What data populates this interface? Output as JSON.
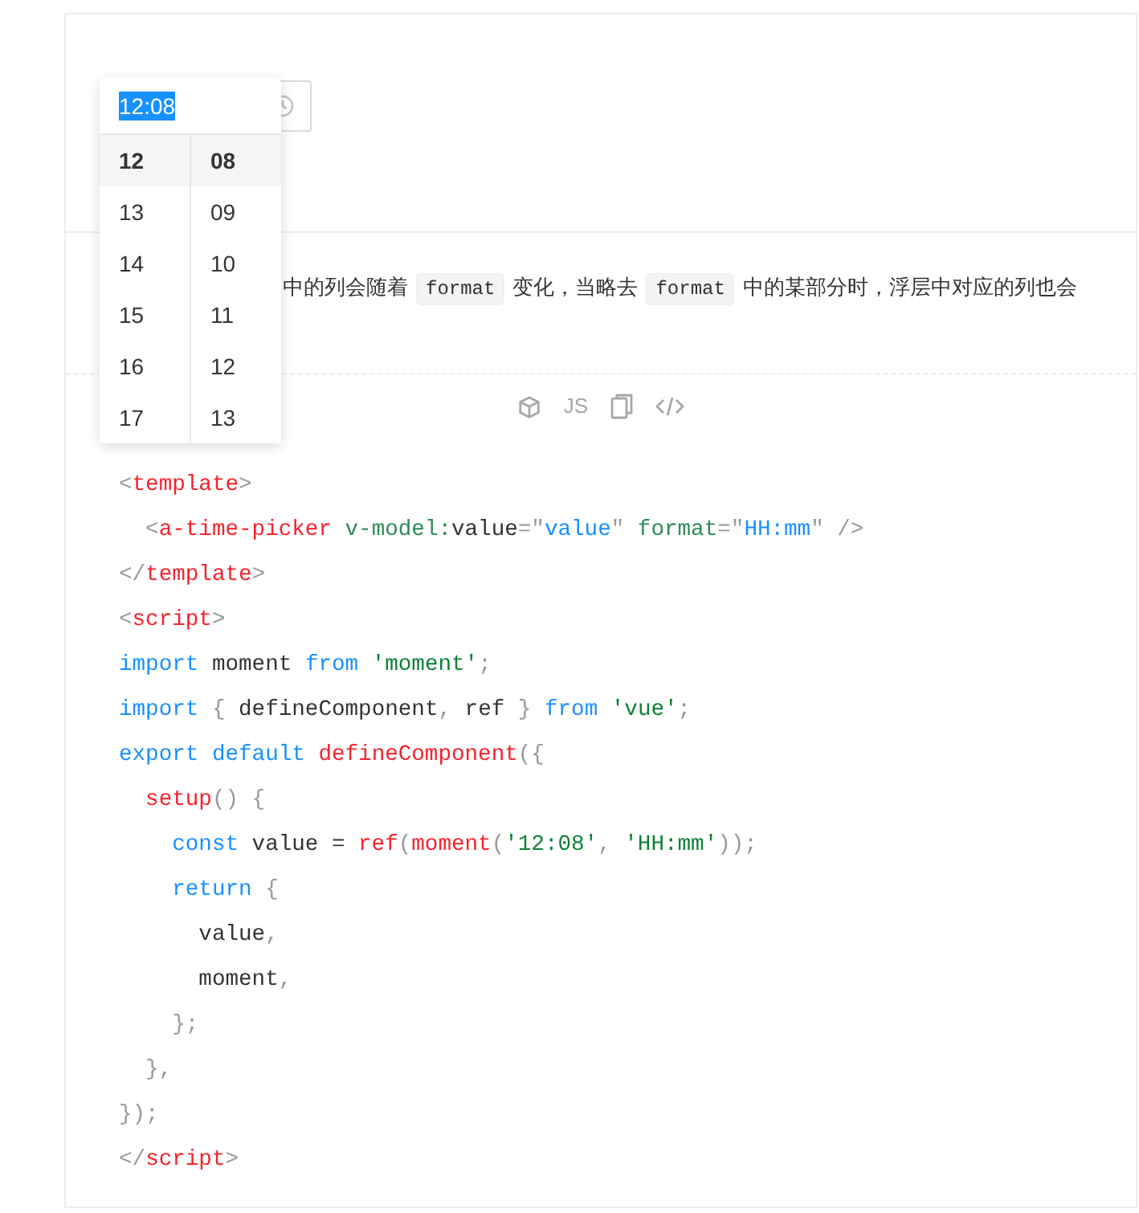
{
  "time_picker": {
    "value": "12:08",
    "columns": [
      {
        "items": [
          {
            "label": "12",
            "selected": true
          },
          {
            "label": "13",
            "selected": false
          },
          {
            "label": "14",
            "selected": false
          },
          {
            "label": "15",
            "selected": false
          },
          {
            "label": "16",
            "selected": false
          },
          {
            "label": "17",
            "selected": false
          }
        ]
      },
      {
        "items": [
          {
            "label": "08",
            "selected": true
          },
          {
            "label": "09",
            "selected": false
          },
          {
            "label": "10",
            "selected": false
          },
          {
            "label": "11",
            "selected": false
          },
          {
            "label": "12",
            "selected": false
          },
          {
            "label": "13",
            "selected": false
          }
        ]
      }
    ]
  },
  "description": [
    {
      "kind": "text",
      "text": "中的列会随着"
    },
    {
      "kind": "code",
      "text": "format"
    },
    {
      "kind": "text",
      "text": "变化，当略去"
    },
    {
      "kind": "code",
      "text": "format"
    },
    {
      "kind": "text",
      "text": "中的某部分时，浮层中对应的列也会"
    }
  ],
  "toolbar": {
    "buttons": [
      {
        "kind": "cube"
      },
      {
        "kind": "js",
        "label": "JS"
      },
      {
        "kind": "copy"
      },
      {
        "kind": "code"
      }
    ]
  },
  "code_lines": [
    {
      "tokens": [
        {
          "kind": "punct",
          "text": "<"
        },
        {
          "kind": "tag",
          "text": "template"
        },
        {
          "kind": "punct",
          "text": ">"
        }
      ]
    },
    {
      "tokens": [
        {
          "kind": "punct",
          "text": "  <"
        },
        {
          "kind": "tag",
          "text": "a-time-picker"
        },
        {
          "kind": "attr",
          "text": " v-model:"
        },
        {
          "kind": "plain",
          "text": "value"
        },
        {
          "kind": "punct",
          "text": "=\""
        },
        {
          "kind": "value",
          "text": "value"
        },
        {
          "kind": "punct",
          "text": "\""
        },
        {
          "kind": "attr",
          "text": " format"
        },
        {
          "kind": "punct",
          "text": "=\""
        },
        {
          "kind": "value",
          "text": "HH:mm"
        },
        {
          "kind": "punct",
          "text": "\" />"
        }
      ]
    },
    {
      "tokens": [
        {
          "kind": "punct",
          "text": "</"
        },
        {
          "kind": "tag",
          "text": "template"
        },
        {
          "kind": "punct",
          "text": ">"
        }
      ]
    },
    {
      "tokens": [
        {
          "kind": "punct",
          "text": "<"
        },
        {
          "kind": "tag",
          "text": "script"
        },
        {
          "kind": "punct",
          "text": ">"
        }
      ]
    },
    {
      "tokens": [
        {
          "kind": "keyword",
          "text": "import"
        },
        {
          "kind": "plain",
          "text": " moment "
        },
        {
          "kind": "keyword",
          "text": "from"
        },
        {
          "kind": "string",
          "text": " 'moment'"
        },
        {
          "kind": "punct",
          "text": ";"
        }
      ]
    },
    {
      "tokens": [
        {
          "kind": "keyword",
          "text": "import"
        },
        {
          "kind": "punct",
          "text": " {"
        },
        {
          "kind": "plain",
          "text": " defineComponent"
        },
        {
          "kind": "punct",
          "text": ","
        },
        {
          "kind": "plain",
          "text": " ref "
        },
        {
          "kind": "punct",
          "text": "}"
        },
        {
          "kind": "keyword",
          "text": " from"
        },
        {
          "kind": "string",
          "text": " 'vue'"
        },
        {
          "kind": "punct",
          "text": ";"
        }
      ]
    },
    {
      "tokens": [
        {
          "kind": "keyword",
          "text": "export default"
        },
        {
          "kind": "func",
          "text": " defineComponent"
        },
        {
          "kind": "punct",
          "text": "({"
        }
      ]
    },
    {
      "tokens": [
        {
          "kind": "func",
          "text": "  setup"
        },
        {
          "kind": "punct",
          "text": "() {"
        }
      ]
    },
    {
      "tokens": [
        {
          "kind": "keyword",
          "text": "    const"
        },
        {
          "kind": "plain",
          "text": " value = "
        },
        {
          "kind": "func",
          "text": "ref"
        },
        {
          "kind": "punct",
          "text": "("
        },
        {
          "kind": "func",
          "text": "moment"
        },
        {
          "kind": "punct",
          "text": "("
        },
        {
          "kind": "string",
          "text": "'12:08'"
        },
        {
          "kind": "punct",
          "text": ", "
        },
        {
          "kind": "string",
          "text": "'HH:mm'"
        },
        {
          "kind": "punct",
          "text": "));"
        }
      ]
    },
    {
      "tokens": [
        {
          "kind": "keyword",
          "text": "    return"
        },
        {
          "kind": "punct",
          "text": " {"
        }
      ]
    },
    {
      "tokens": [
        {
          "kind": "plain",
          "text": "      value"
        },
        {
          "kind": "punct",
          "text": ","
        }
      ]
    },
    {
      "tokens": [
        {
          "kind": "plain",
          "text": "      moment"
        },
        {
          "kind": "punct",
          "text": ","
        }
      ]
    },
    {
      "tokens": [
        {
          "kind": "punct",
          "text": "    };"
        }
      ]
    },
    {
      "tokens": [
        {
          "kind": "punct",
          "text": "  },"
        }
      ]
    },
    {
      "tokens": [
        {
          "kind": "punct",
          "text": "});"
        }
      ]
    },
    {
      "tokens": [
        {
          "kind": "punct",
          "text": "</"
        },
        {
          "kind": "tag",
          "text": "script"
        },
        {
          "kind": "punct",
          "text": ">"
        }
      ]
    }
  ]
}
